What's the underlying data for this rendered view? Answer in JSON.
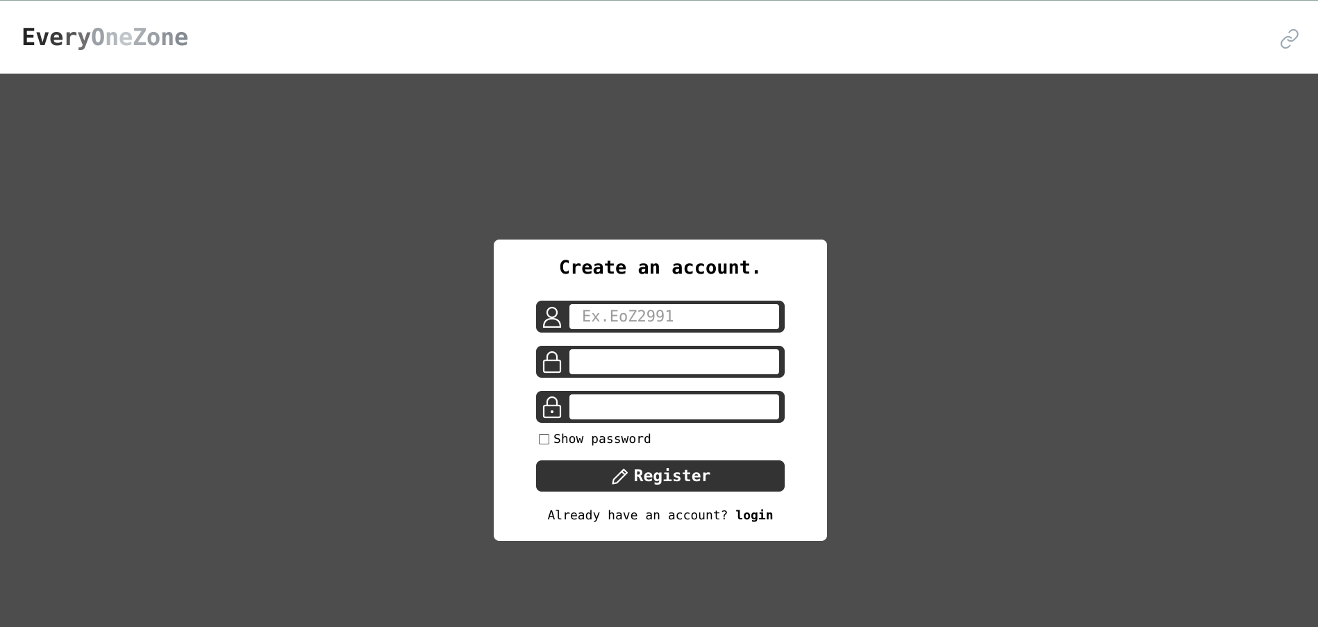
{
  "header": {
    "logo_parts": [
      {
        "text": "E",
        "color": "#222222"
      },
      {
        "text": "v",
        "color": "#2e2e2e"
      },
      {
        "text": "e",
        "color": "#3a3a3a"
      },
      {
        "text": "r",
        "color": "#555555"
      },
      {
        "text": "y",
        "color": "#707070"
      },
      {
        "text": "O",
        "color": "#9aa0a6"
      },
      {
        "text": "n",
        "color": "#b3b8bd"
      },
      {
        "text": "e",
        "color": "#c2c6ca"
      },
      {
        "text": "Z",
        "color": "#a7adb3"
      },
      {
        "text": "o",
        "color": "#9aa0a6"
      },
      {
        "text": "n",
        "color": "#8e949a"
      },
      {
        "text": "e",
        "color": "#858b91"
      }
    ],
    "link_icon": "link-icon"
  },
  "form": {
    "title": "Create an account.",
    "username": {
      "icon": "user-icon",
      "placeholder": "Ex.EoZ2991",
      "value": ""
    },
    "password": {
      "icon": "lock-icon",
      "placeholder": "",
      "value": ""
    },
    "confirm_password": {
      "icon": "lock-keyhole-icon",
      "placeholder": "",
      "value": ""
    },
    "show_password_label": "Show password",
    "show_password_checked": false,
    "register_label": "Register",
    "register_icon": "pencil-icon",
    "footer_prompt": "Already have an account? ",
    "login_link": "login"
  },
  "colors": {
    "background": "#4d4d4d",
    "dark": "#333333",
    "card": "#ffffff"
  }
}
